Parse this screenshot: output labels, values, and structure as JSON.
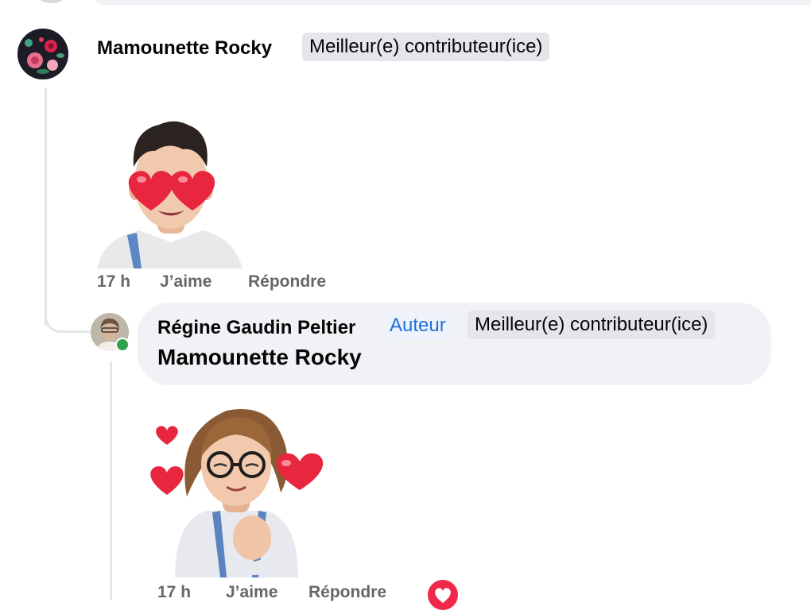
{
  "comment1": {
    "author": "Mamounette Rocky",
    "badge": "Meilleur(e) contributeur(ice)",
    "sticker": "memoji-heart-eyes-sticker",
    "actions": {
      "time": "17 h",
      "like": "J’aime",
      "reply": "Répondre"
    }
  },
  "reply1": {
    "author": "Régine Gaudin Peltier",
    "author_badge": "Auteur",
    "badge": "Meilleur(e) contributeur(ice)",
    "text": "Mamounette Rocky",
    "online": true,
    "sticker": "memoji-hearts-sticker",
    "reaction_icon": "heart-reaction-icon",
    "actions": {
      "time": "17 h",
      "like": "J’aime",
      "reply": "Répondre"
    }
  },
  "colors": {
    "bubble": "#f0f2f5",
    "badge_bg": "#e4e6eb",
    "author_blue": "#216fdb",
    "meta_gray": "#65676b",
    "online_green": "#31a24c",
    "heart_red": "#f0284a"
  }
}
